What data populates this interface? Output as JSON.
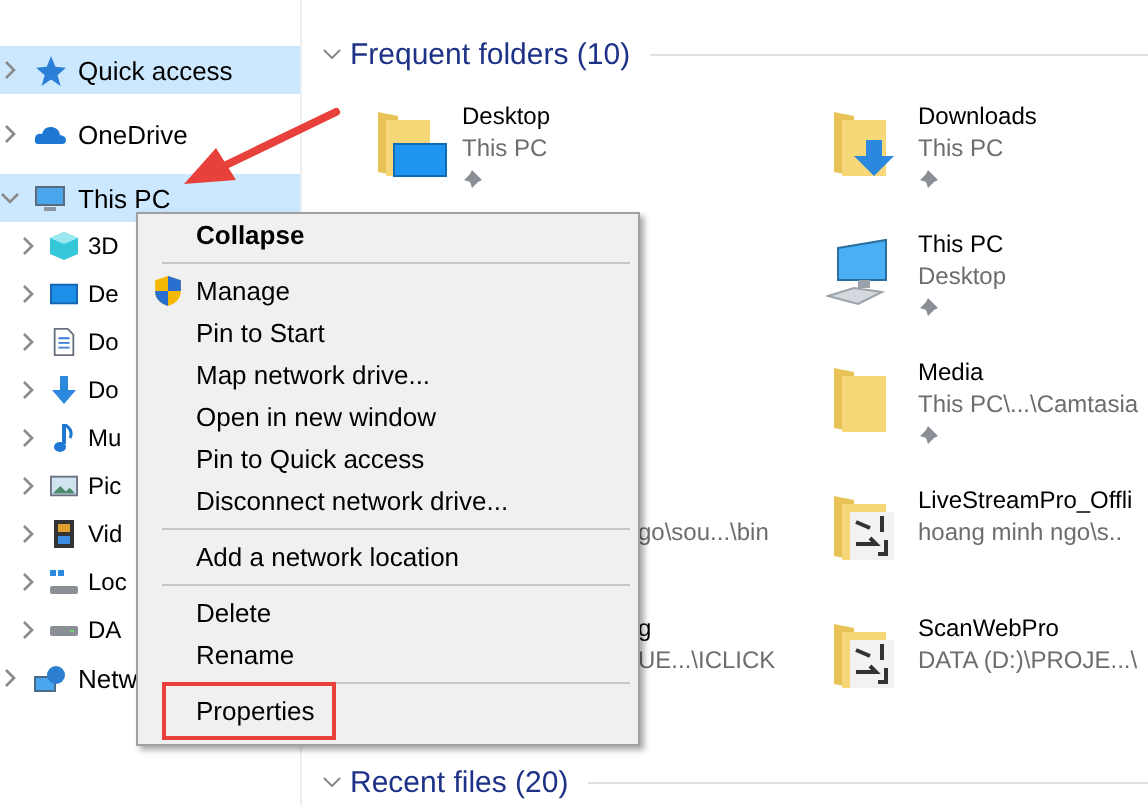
{
  "sidebar": {
    "items": [
      {
        "label": "Quick access",
        "selected": true,
        "expanded": false
      },
      {
        "label": "OneDrive",
        "selected": false,
        "expanded": false
      },
      {
        "label": "This PC",
        "selected": true,
        "expanded": true,
        "children": [
          {
            "label": "3D",
            "selected": false,
            "expanded": false
          },
          {
            "label": "De",
            "selected": false,
            "expanded": false
          },
          {
            "label": "Do",
            "selected": false,
            "expanded": false
          },
          {
            "label": "Do",
            "selected": false,
            "expanded": false
          },
          {
            "label": "Mu",
            "selected": false,
            "expanded": false
          },
          {
            "label": "Pic",
            "selected": false,
            "expanded": false
          },
          {
            "label": "Vid",
            "selected": false,
            "expanded": false
          },
          {
            "label": "Loc",
            "selected": false,
            "expanded": false
          },
          {
            "label": "DA",
            "selected": false,
            "expanded": false
          }
        ]
      },
      {
        "label": "Netw",
        "selected": false,
        "expanded": false
      }
    ]
  },
  "frequent_folders": {
    "title": "Frequent folders (10)",
    "expanded": true,
    "rows": [
      {
        "left": {
          "kind": "full",
          "name": "Desktop",
          "location": "This PC",
          "pinned": true
        },
        "right": {
          "kind": "full",
          "name": "Downloads",
          "location": "This PC",
          "pinned": true
        }
      },
      {
        "right": {
          "kind": "full",
          "name": "This PC",
          "location": "Desktop",
          "pinned": true
        }
      },
      {
        "right": {
          "kind": "full",
          "name": "Media",
          "location": "This PC\\...\\Camtasia",
          "pinned": true
        }
      },
      {
        "left": {
          "kind": "partial",
          "location": "go\\sou...\\bin"
        },
        "right": {
          "kind": "full",
          "name": "LiveStreamPro_Offli",
          "location": "hoang minh ngo\\s..",
          "pinned": false
        }
      },
      {
        "left": {
          "kind": "partial",
          "name": "g",
          "location": "UE...\\ICLICK"
        },
        "right": {
          "kind": "full",
          "name": "ScanWebPro",
          "location": "DATA (D:)\\PROJE...\\",
          "pinned": false
        }
      }
    ]
  },
  "recent_files": {
    "title": "Recent files (20)",
    "expanded": true
  },
  "context_menu": {
    "items": [
      {
        "kind": "item",
        "label": "Collapse",
        "default": true,
        "highlighted": false
      },
      {
        "kind": "separator"
      },
      {
        "kind": "item",
        "label": "Manage",
        "default": false,
        "highlighted": false
      },
      {
        "kind": "item",
        "label": "Pin to Start",
        "default": false,
        "highlighted": false
      },
      {
        "kind": "item",
        "label": "Map network drive...",
        "default": false,
        "highlighted": false
      },
      {
        "kind": "item",
        "label": "Open in new window",
        "default": false,
        "highlighted": false
      },
      {
        "kind": "item",
        "label": "Pin to Quick access",
        "default": false,
        "highlighted": false
      },
      {
        "kind": "item",
        "label": "Disconnect network drive...",
        "default": false,
        "highlighted": false
      },
      {
        "kind": "separator"
      },
      {
        "kind": "item",
        "label": "Add a network location",
        "default": false,
        "highlighted": false
      },
      {
        "kind": "separator"
      },
      {
        "kind": "item",
        "label": "Delete",
        "default": false,
        "highlighted": false
      },
      {
        "kind": "item",
        "label": "Rename",
        "default": false,
        "highlighted": false
      },
      {
        "kind": "separator"
      },
      {
        "kind": "item",
        "label": "Properties",
        "default": false,
        "highlighted": true
      }
    ]
  }
}
